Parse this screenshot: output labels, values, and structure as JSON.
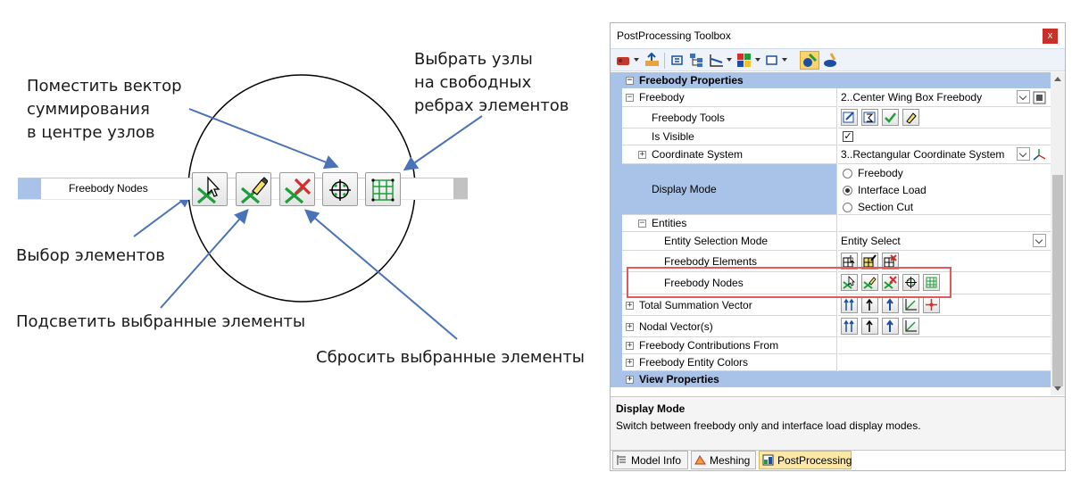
{
  "annotations": {
    "place_vector": "Поместить вектор\nсуммирования\nв центре узлов",
    "select_free_edge_nodes": "Выбрать узлы\nна свободных\nребрах элементов",
    "select_elements": "Выбор элементов",
    "highlight_selected": "Подсветить выбранные элементы",
    "reset_selected": "Сбросить выбранные элементы",
    "zoom_row_label": "Freebody Nodes"
  },
  "panel": {
    "title": "PostProcessing Toolbox",
    "close_label": "x",
    "sections": {
      "freebody_properties": "Freebody Properties",
      "view_properties": "View Properties"
    },
    "rows": {
      "freebody": {
        "label": "Freebody",
        "value": "2..Center Wing Box Freebody"
      },
      "freebody_tools": {
        "label": "Freebody Tools"
      },
      "is_visible": {
        "label": "Is Visible",
        "checked": true,
        "check_glyph": "✓"
      },
      "coordinate_system": {
        "label": "Coordinate System",
        "value": "3..Rectangular Coordinate System"
      },
      "display_mode": {
        "label": "Display Mode",
        "options": [
          "Freebody",
          "Interface Load",
          "Section Cut"
        ],
        "selected": "Interface Load"
      },
      "entities": {
        "label": "Entities"
      },
      "entity_selection_mode": {
        "label": "Entity Selection Mode",
        "value": "Entity Select"
      },
      "freebody_elements": {
        "label": "Freebody Elements"
      },
      "freebody_nodes": {
        "label": "Freebody Nodes"
      },
      "total_summation_vector": {
        "label": "Total Summation Vector"
      },
      "nodal_vectors": {
        "label": "Nodal Vector(s)"
      },
      "freebody_contributions_from": {
        "label": "Freebody Contributions From"
      },
      "freebody_entity_colors": {
        "label": "Freebody Entity Colors"
      }
    },
    "expander": {
      "expanded": "−",
      "collapsed": "+"
    },
    "description": {
      "title": "Display Mode",
      "text": "Switch between freebody only and interface load display modes."
    },
    "tabs": [
      {
        "label": "Model Info",
        "active": false
      },
      {
        "label": "Meshing",
        "active": false
      },
      {
        "label": "PostProcessing",
        "active": true
      }
    ]
  },
  "colors": {
    "category_blue": "#a9c3e8",
    "highlight_red": "#e05a5a",
    "annotation_arrow": "#4a72b8",
    "icon_green": "#1e9e3a",
    "icon_red": "#d32f2f",
    "active_tab": "#fbe8a6"
  },
  "icons": {
    "toolbar": [
      "freebody-tool-icon",
      "load-icon",
      "refresh-icon",
      "tree-icon",
      "plot-icon",
      "chart-icon",
      "square-icon",
      "freebody-active-icon",
      "paint-icon"
    ],
    "freebody_nodes_buttons": [
      "select-nodes-icon",
      "highlight-nodes-icon",
      "reset-nodes-icon",
      "place-vector-center-icon",
      "select-free-edge-nodes-icon"
    ]
  }
}
